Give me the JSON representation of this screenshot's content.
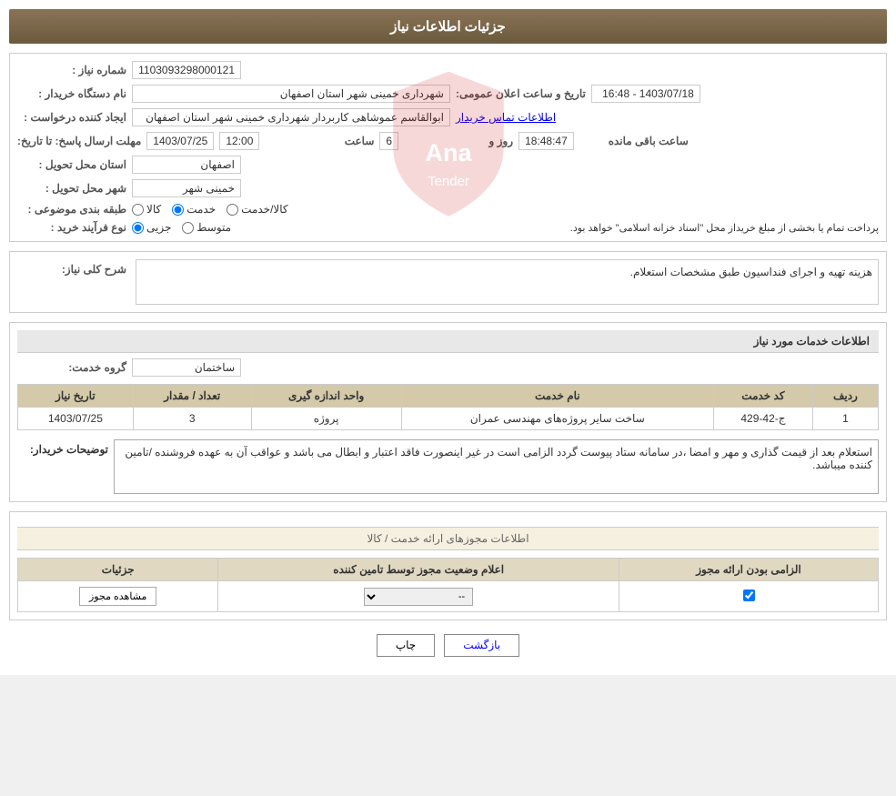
{
  "header": {
    "title": "جزئیات اطلاعات نیاز"
  },
  "fields": {
    "need_number_label": "شماره نیاز :",
    "need_number_value": "1103093298000121",
    "buyer_org_label": "نام دستگاه خریدار :",
    "buyer_org_value": "شهرداری خمینی شهر استان اصفهان",
    "requester_label": "ایجاد کننده درخواست :",
    "requester_value": "ابوالقاسم عموشاهی کاربردار شهرداری خمینی شهر استان اصفهان",
    "contact_link": "اطلاعات تماس خریدار",
    "response_deadline_label": "مهلت ارسال پاسخ: تا تاریخ:",
    "response_date": "1403/07/25",
    "response_time_label": "ساعت",
    "response_time": "12:00",
    "response_days_label": "روز و",
    "response_days": "6",
    "response_remaining_label": "ساعت باقی مانده",
    "response_remaining": "18:48:47",
    "announce_label": "تاریخ و ساعت اعلان عمومی:",
    "announce_value": "1403/07/18 - 16:48",
    "province_label": "استان محل تحویل :",
    "province_value": "اصفهان",
    "city_label": "شهر محل تحویل :",
    "city_value": "خمینی شهر",
    "category_label": "طبقه بندی موضوعی :",
    "category_options": [
      "کالا",
      "خدمت",
      "کالا/خدمت"
    ],
    "category_selected": "خدمت",
    "purchase_type_label": "نوع فرآیند خرید :",
    "purchase_options": [
      "جزیی",
      "متوسط"
    ],
    "purchase_note": "پرداخت تمام یا بخشی از مبلغ خریداز محل \"اسناد خزانه اسلامی\" خواهد بود.",
    "general_desc_label": "شرح کلی نیاز:",
    "general_desc_value": "هزینه تهیه و اجرای فنداسیون طبق مشخصات استعلام.",
    "service_info_label": "اطلاعات خدمات مورد نیاز",
    "service_group_label": "گروه خدمت:",
    "service_group_value": "ساختمان"
  },
  "table": {
    "headers": [
      "ردیف",
      "کد خدمت",
      "نام خدمت",
      "واحد اندازه گیری",
      "تعداد / مقدار",
      "تاریخ نیاز"
    ],
    "rows": [
      {
        "row": "1",
        "code": "ج-42-429",
        "name": "ساخت سایر پروژه‌های مهندسی عمران",
        "unit": "پروژه",
        "quantity": "3",
        "date": "1403/07/25"
      }
    ]
  },
  "buyer_notes_label": "توضیحات خریدار:",
  "buyer_notes_value": "استعلام بعد از قیمت گذاری و مهر و امضا ،در سامانه ستاد پیوست گردد الزامی است در غیر اینصورت فاقد اعتبار و ابطال می باشد و عواقب آن به عهده فروشنده /تامین کننده میباشد.",
  "permit_section_title": "اطلاعات مجوزهای ارائه خدمت / کالا",
  "permit_table": {
    "headers": [
      "الزامی بودن ارائه مجوز",
      "اعلام وضعیت مجوز توسط تامین کننده",
      "جزئیات"
    ],
    "rows": [
      {
        "required": true,
        "status": "--",
        "details_btn": "مشاهده مجوز"
      }
    ]
  },
  "buttons": {
    "print": "چاپ",
    "back": "بازگشت"
  }
}
